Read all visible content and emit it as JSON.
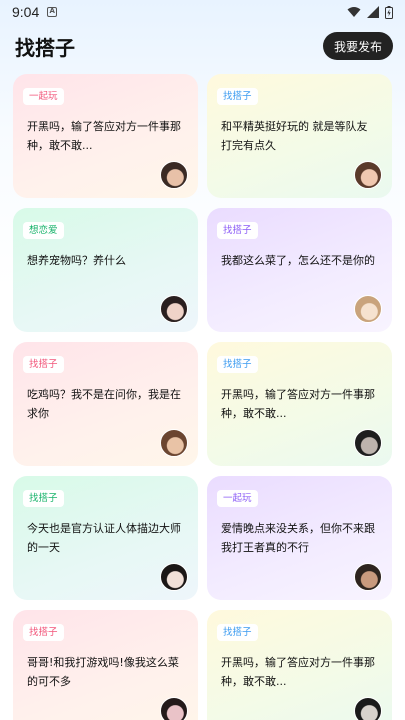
{
  "status_bar": {
    "time": "9:04",
    "notif_glyph": "A"
  },
  "header": {
    "title": "找搭子",
    "publish_label": "我要发布"
  },
  "colors": {
    "tag_pink": "#f2557a",
    "tag_blue": "#3b9bf0",
    "tag_green": "#19b36b",
    "tag_purple": "#8b5cf6"
  },
  "cards": [
    {
      "tag": "一起玩",
      "tag_color": "#f2557a",
      "theme": "pink",
      "text": "开黑吗，输了答应对方一件事那种，敢不敢...",
      "avatar": [
        "#3a2a24",
        "#e8c1a8"
      ]
    },
    {
      "tag": "找搭子",
      "tag_color": "#3b9bf0",
      "theme": "yellow",
      "text": "和平精英挺好玩的 就是等队友打完有点久",
      "avatar": [
        "#5a3a2a",
        "#f0c8b0"
      ]
    },
    {
      "tag": "想恋爱",
      "tag_color": "#19b36b",
      "theme": "green",
      "text": "想养宠物吗？养什么",
      "avatar": [
        "#2a1f1f",
        "#efd3c8"
      ]
    },
    {
      "tag": "找搭子",
      "tag_color": "#8b5cf6",
      "theme": "purple",
      "text": "我都这么菜了，怎么还不是你的",
      "avatar": [
        "#c9a37c",
        "#f6e2cf"
      ]
    },
    {
      "tag": "找搭子",
      "tag_color": "#f2557a",
      "theme": "pink",
      "text": "吃鸡吗？我不是在问你，我是在求你",
      "avatar": [
        "#6b4530",
        "#e9c3a6"
      ]
    },
    {
      "tag": "找搭子",
      "tag_color": "#3b9bf0",
      "theme": "yellow",
      "text": "开黑吗，输了答应对方一件事那种，敢不敢...",
      "avatar": [
        "#1e1e1e",
        "#bdb3ad"
      ]
    },
    {
      "tag": "找搭子",
      "tag_color": "#19b36b",
      "theme": "green",
      "text": "今天也是官方认证人体描边大师的一天",
      "avatar": [
        "#1b1716",
        "#f1e0d8"
      ]
    },
    {
      "tag": "一起玩",
      "tag_color": "#8b5cf6",
      "theme": "purple",
      "text": "爱情晚点来没关系，但你不来跟我打王者真的不行",
      "avatar": [
        "#2e241f",
        "#c99a7e"
      ]
    },
    {
      "tag": "找搭子",
      "tag_color": "#f2557a",
      "theme": "pink",
      "text": "哥哥!和我打游戏吗!像我这么菜的可不多",
      "avatar": [
        "#241a1a",
        "#eac3c8"
      ]
    },
    {
      "tag": "找搭子",
      "tag_color": "#3b9bf0",
      "theme": "yellow",
      "text": "开黑吗，输了答应对方一件事那种，敢不敢...",
      "avatar": [
        "#1a1a1a",
        "#d8d2cc"
      ]
    }
  ]
}
